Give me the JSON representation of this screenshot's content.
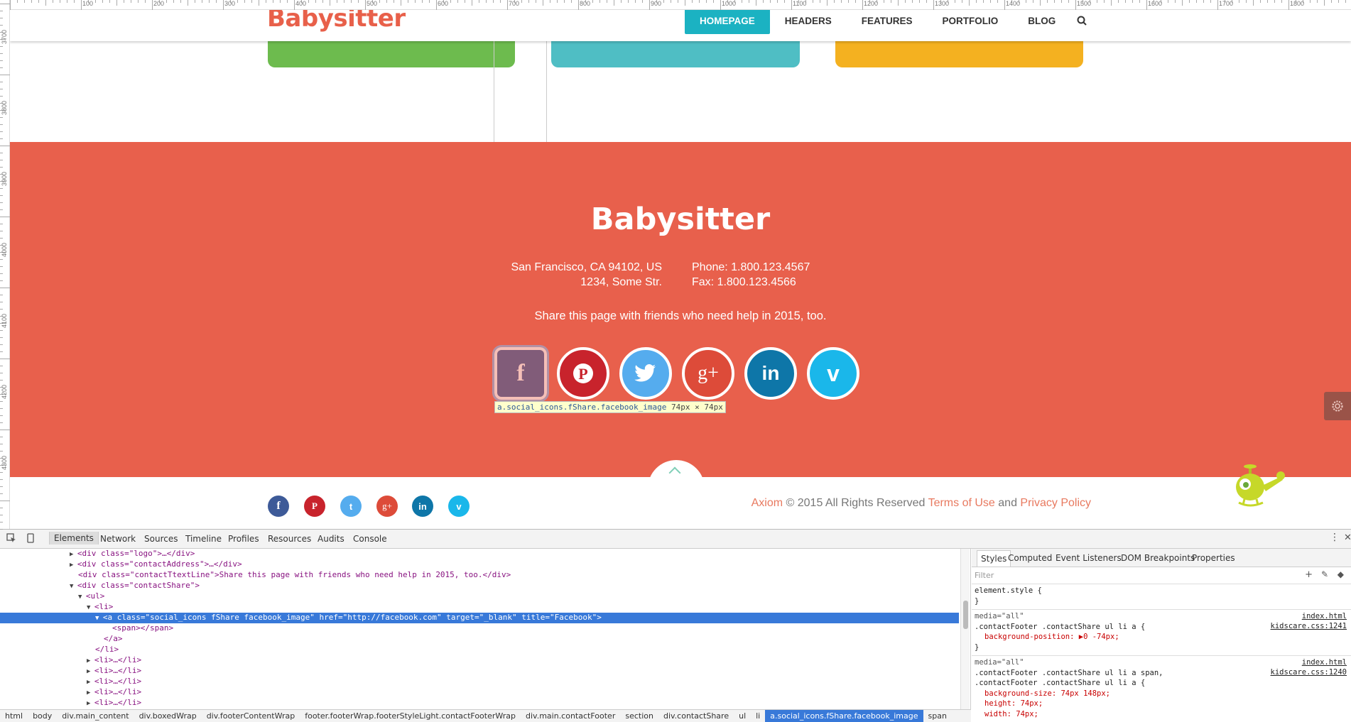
{
  "ruler": {
    "top_labels": [
      "100",
      "200",
      "300",
      "400",
      "500",
      "600",
      "700",
      "800",
      "900",
      "1000",
      "1100",
      "1200",
      "1300",
      "1400",
      "1500",
      "1600",
      "1700",
      "1800"
    ],
    "left_labels": [
      "3700",
      "3800",
      "3900",
      "4000",
      "4100",
      "4200",
      "4300"
    ]
  },
  "header": {
    "logo": "Babysitter",
    "nav": [
      "HOMEPAGE",
      "HEADERS",
      "FEATURES",
      "PORTFOLIO",
      "BLOG"
    ],
    "search_icon": "search-icon"
  },
  "cards": [
    {
      "color": "#6dbb4e"
    },
    {
      "color": "#4fbec4"
    },
    {
      "color": "#f4b120"
    }
  ],
  "footer": {
    "bg_color": "#e8604c",
    "logo": "Babysitter",
    "address_line1": "San Francisco, CA 94102, US",
    "address_line2": "1234, Some Str.",
    "phone": "Phone: 1.800.123.4567",
    "fax": "Fax: 1.800.123.4566",
    "share_text": "Share this page with friends who need help in 2015, too.",
    "social_big": [
      {
        "name": "facebook",
        "glyph": "f",
        "color": "#3d5a98"
      },
      {
        "name": "pinterest",
        "glyph": "P",
        "color": "#c8232c"
      },
      {
        "name": "twitter",
        "glyph": "t",
        "color": "#55acee"
      },
      {
        "name": "google-plus",
        "glyph": "g+",
        "color": "#dd4b39"
      },
      {
        "name": "linkedin",
        "glyph": "in",
        "color": "#0e76a8"
      },
      {
        "name": "vimeo",
        "glyph": "v",
        "color": "#1ab7ea"
      }
    ],
    "tooltip_selector": "a.social_icons.fShare.facebook_image",
    "tooltip_size": "74px × 74px"
  },
  "bottom": {
    "social_small": [
      {
        "name": "facebook",
        "glyph": "f",
        "color": "#3d5a98"
      },
      {
        "name": "pinterest",
        "glyph": "P",
        "color": "#c8232c"
      },
      {
        "name": "twitter",
        "glyph": "t",
        "color": "#55acee"
      },
      {
        "name": "google-plus",
        "glyph": "g+",
        "color": "#dd4b39"
      },
      {
        "name": "linkedin",
        "glyph": "in",
        "color": "#0e76a8"
      },
      {
        "name": "vimeo",
        "glyph": "v",
        "color": "#1ab7ea"
      }
    ],
    "brand": "Axiom",
    "copyright": " © 2015 All Rights Reserved ",
    "terms": "Terms of Use",
    "and": " and ",
    "privacy": "Privacy Policy"
  },
  "devtools": {
    "tabs": [
      "Elements",
      "Network",
      "Sources",
      "Timeline",
      "Profiles",
      "Resources",
      "Audits",
      "Console"
    ],
    "elements_lines": [
      {
        "tri": "▶",
        "html": "<span class=\"tg\">&lt;div </span><span class=\"an\">class</span>=\"<span class=\"av\">logo</span>\"&gt;…&lt;/div&gt;"
      },
      {
        "tri": "▶",
        "html": "&lt;div <span class=\"an\">class</span>=\"<span class=\"av\">contactAddress</span>\"&gt;…&lt;/div&gt;"
      },
      {
        "tri": "",
        "html": "&lt;div <span class=\"an\">class</span>=\"<span class=\"av\">contactTextLine</span>\"&gt;<span class=\"tx\">Share this page with friends who need help in 2015, too.</span>&lt;/div&gt;"
      }
    ],
    "elements_text": [
      "<div class=\"logo\">…</div>",
      "<div class=\"contactAddress\">…</div>",
      "<div class=\"contactTtextLine\">Share this page with friends who need help in 2015, too.</div>",
      "<div class=\"contactShare\">",
      "<ul>",
      "<li>",
      "<a class=\"social_icons fShare facebook_image\" href=\"http://facebook.com\" target=\"_blank\" title=\"Facebook\">",
      "<span></span>",
      "</a>",
      "</li>",
      "<li>…</li>",
      "<li>…</li>",
      "<li>…</li>",
      "<li>…</li>",
      "<li>…</li>"
    ],
    "breadcrumbs": [
      "html",
      "body",
      "div.main_content",
      "div.boxedWrap",
      "div.footerContentWrap",
      "footer.footerWrap.footerStyleLight.contactFooterWrap",
      "div.main.contactFooter",
      "section",
      "div.contactShare",
      "ul",
      "li",
      "a.social_icons.fShare.facebook_image",
      "span"
    ],
    "styles_tabs": [
      "Styles",
      "Computed",
      "Event Listeners",
      "DOM Breakpoints",
      "Properties"
    ],
    "filter_placeholder": "Filter",
    "rules": [
      {
        "media": "",
        "selector": "element.style {",
        "src": "",
        "props": [],
        "close": "}"
      },
      {
        "media": "media=\"all\"",
        "selector": ".contactFooter .contactShare ul li a {",
        "src_file": "index.html",
        "src": "kidscare.css:1241",
        "props": [
          "background-position: ▶0 -74px;"
        ],
        "close": "}"
      },
      {
        "media": "media=\"all\"",
        "selector": ".contactFooter .contactShare ul li a span, .contactFooter .contactShare ul li a {",
        "src_file": "index.html",
        "src": "kidscare.css:1240",
        "props": [
          "background-size: 74px 148px;",
          "height: 74px;",
          "width: 74px;"
        ],
        "close": ""
      }
    ]
  }
}
